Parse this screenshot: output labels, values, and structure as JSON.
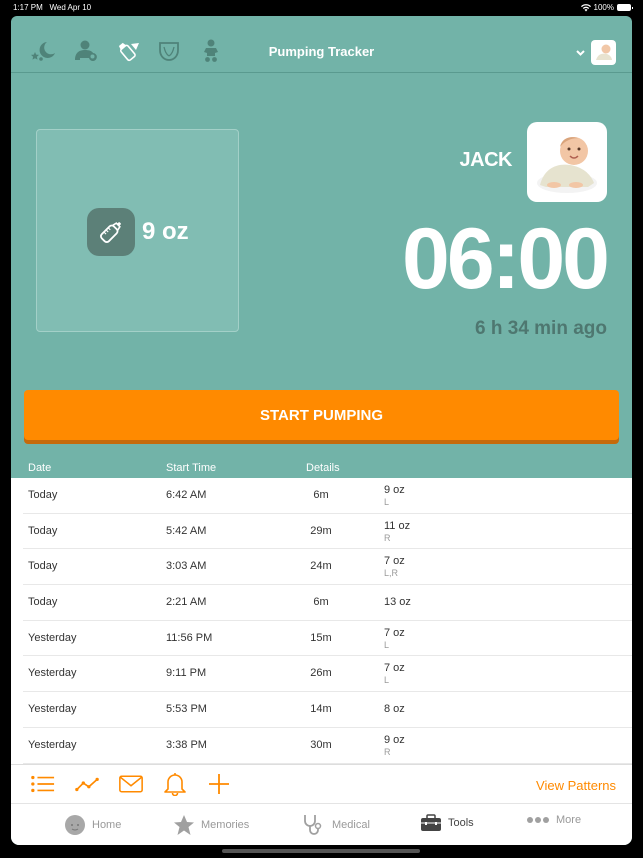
{
  "status_bar": {
    "time": "1:17 PM",
    "date": "Wed Apr 10",
    "battery": "100%"
  },
  "navbar": {
    "title": "Pumping Tracker",
    "icons": [
      "sleep-icon",
      "nursing-icon",
      "bottle-icon",
      "diaper-icon",
      "baby-icon"
    ]
  },
  "current": {
    "amount": "9 oz",
    "child_name": "JACK",
    "timer": "06:00",
    "ago": "6 h 34 min ago"
  },
  "start_button": "START PUMPING",
  "table": {
    "headers": {
      "date": "Date",
      "start_time": "Start Time",
      "details": "Details"
    },
    "rows": [
      {
        "date": "Today",
        "time": "6:42 AM",
        "duration": "6m",
        "amount": "9 oz",
        "side": "L"
      },
      {
        "date": "Today",
        "time": "5:42 AM",
        "duration": "29m",
        "amount": "11 oz",
        "side": "R"
      },
      {
        "date": "Today",
        "time": "3:03 AM",
        "duration": "24m",
        "amount": "7 oz",
        "side": "L,R"
      },
      {
        "date": "Today",
        "time": "2:21 AM",
        "duration": "6m",
        "amount": "13 oz",
        "side": ""
      },
      {
        "date": "Yesterday",
        "time": "11:56 PM",
        "duration": "15m",
        "amount": "7 oz",
        "side": "L"
      },
      {
        "date": "Yesterday",
        "time": "9:11 PM",
        "duration": "26m",
        "amount": "7 oz",
        "side": "L"
      },
      {
        "date": "Yesterday",
        "time": "5:53 PM",
        "duration": "14m",
        "amount": "8 oz",
        "side": ""
      },
      {
        "date": "Yesterday",
        "time": "3:38 PM",
        "duration": "30m",
        "amount": "9 oz",
        "side": "R"
      }
    ]
  },
  "toolbar": {
    "view_patterns": "View Patterns"
  },
  "tabs": [
    {
      "label": "Home",
      "active": false
    },
    {
      "label": "Memories",
      "active": false
    },
    {
      "label": "Medical",
      "active": false
    },
    {
      "label": "Tools",
      "active": true
    },
    {
      "label": "More",
      "active": false
    }
  ],
  "colors": {
    "teal": "#72b3a8",
    "accent": "#ff8a00",
    "dark_teal": "#5c8078"
  }
}
